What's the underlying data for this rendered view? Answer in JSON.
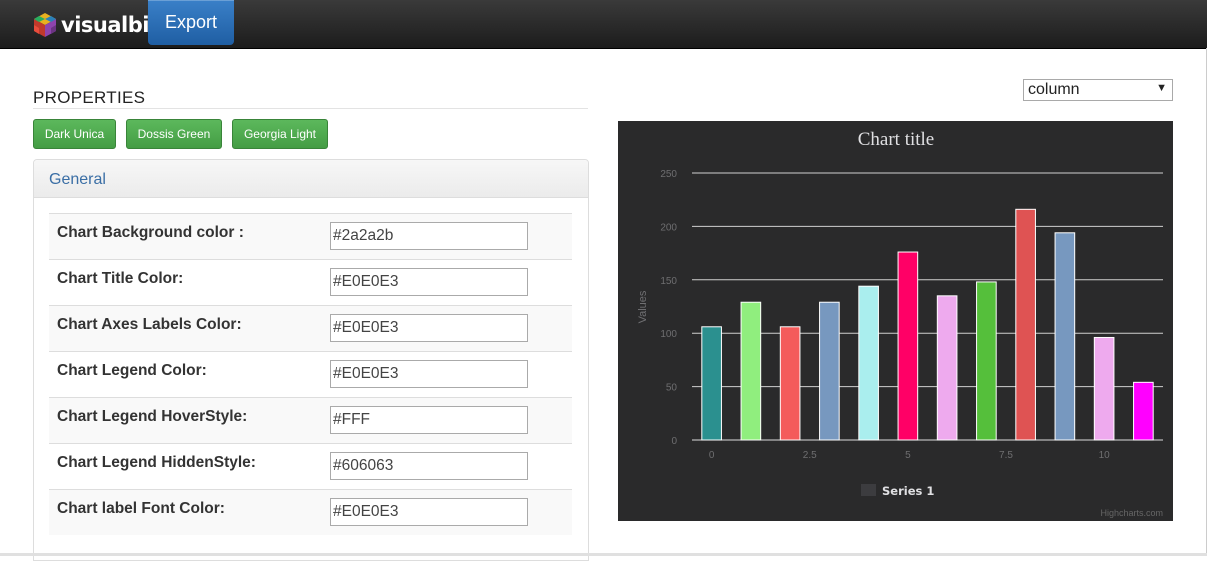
{
  "navbar": {
    "logo_text": "visualbi",
    "export_label": "Export"
  },
  "properties": {
    "heading": "PROPERTIES",
    "themes": [
      "Dark Unica",
      "Dossis Green",
      "Georgia Light"
    ],
    "panel_title": "General",
    "rows": [
      {
        "label": "Chart Background color :",
        "value": "#2a2a2b"
      },
      {
        "label": "Chart Title Color:",
        "value": "#E0E0E3"
      },
      {
        "label": "Chart Axes Labels Color:",
        "value": "#E0E0E3"
      },
      {
        "label": "Chart Legend Color:",
        "value": "#E0E0E3"
      },
      {
        "label": "Chart Legend HoverStyle:",
        "value": "#FFF"
      },
      {
        "label": "Chart Legend HiddenStyle:",
        "value": "#606063"
      },
      {
        "label": "Chart label Font Color:",
        "value": "#E0E0E3"
      }
    ]
  },
  "chart_type_select": {
    "selected": "column"
  },
  "chart_data": {
    "type": "bar",
    "title": "Chart title",
    "ylabel": "Values",
    "xlabel": "",
    "x": [
      0,
      1,
      2,
      3,
      4,
      5,
      6,
      7,
      8,
      9,
      10,
      11
    ],
    "values": [
      106,
      129,
      106,
      129,
      144,
      176,
      135,
      148,
      216,
      194,
      96,
      54
    ],
    "colors": [
      "#2b908f",
      "#90ee7e",
      "#f45b5b",
      "#7798bf",
      "#aaeeee",
      "#ff0066",
      "#eeaaee",
      "#55bf3b",
      "#df5353",
      "#7798bf",
      "#eeaaee",
      "#ff00ff"
    ],
    "ylim": [
      0,
      250
    ],
    "yticks": [
      0,
      50,
      100,
      150,
      200,
      250
    ],
    "xlim": [
      -0.5,
      11.5
    ],
    "xticks": [
      0,
      2.5,
      5,
      7.5,
      10
    ],
    "xtick_labels": [
      "0",
      "2.5",
      "5",
      "7.5",
      "10"
    ],
    "legend": [
      "Series 1"
    ],
    "legend_position": "bottom-center",
    "credit": "Highcharts.com",
    "background": "#2a2a2b",
    "text_color": "#E0E0E3",
    "grid": true
  }
}
